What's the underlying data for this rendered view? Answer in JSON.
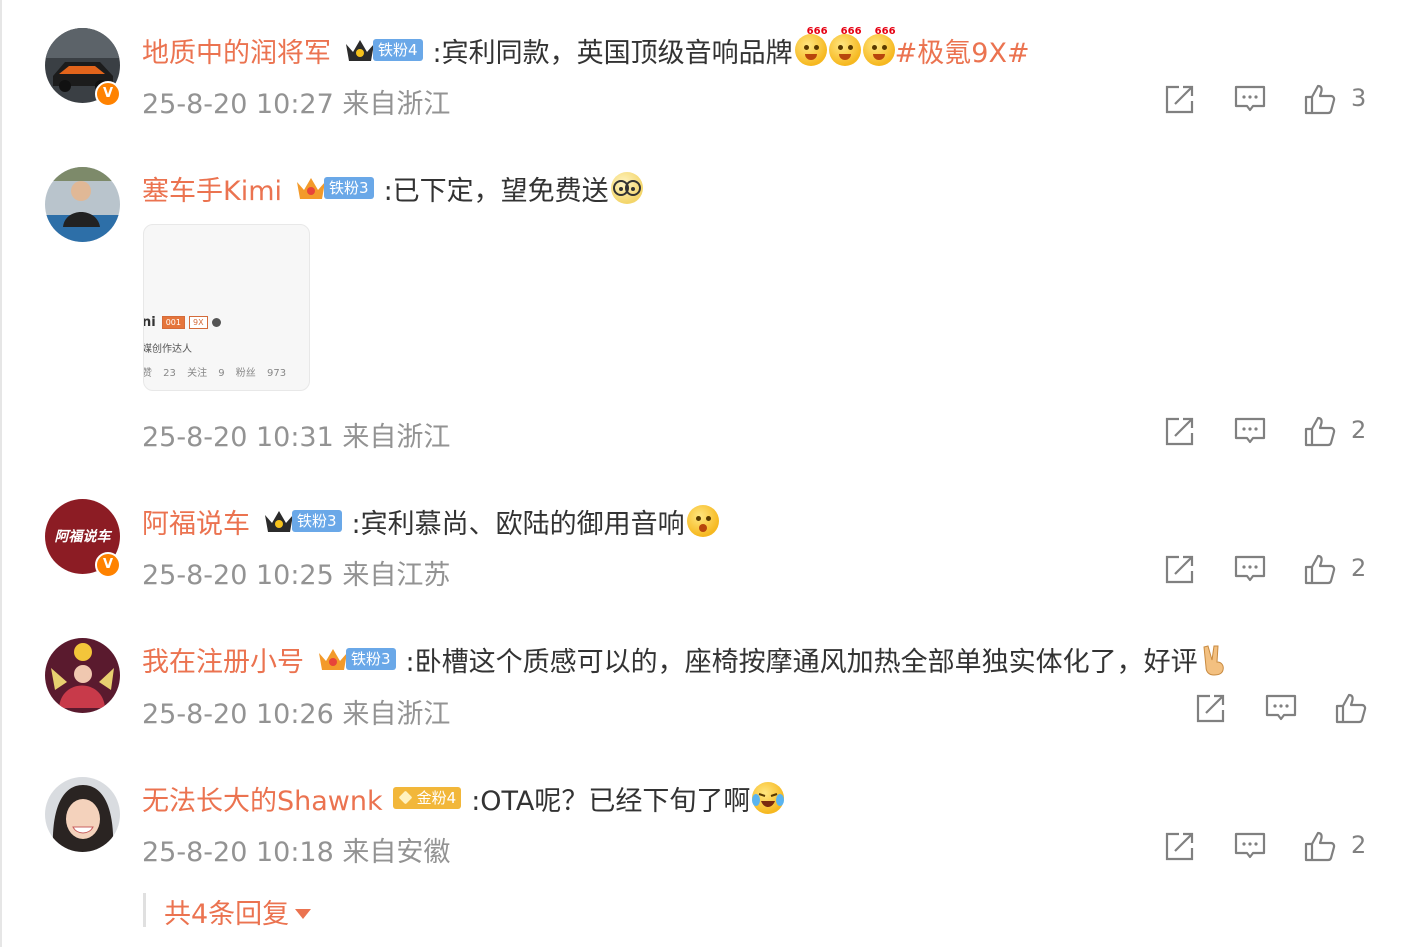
{
  "comments": [
    {
      "user": "地质中的润将军",
      "fan_badge": "铁粉4",
      "text": ":宾利同款，英国顶级音响品牌",
      "emoji": [
        "666-emoji",
        "666-emoji",
        "666-emoji"
      ],
      "topic": "#极氪9X#",
      "time": "25-8-20 10:27 来自浙江",
      "likes": "3",
      "verified": true
    },
    {
      "user": "塞车手Kimi",
      "fan_badge": "铁粉3",
      "text": ":已下定，望免费送",
      "emoji": [
        "glasses-emoji"
      ],
      "attachment": {
        "name": "ni",
        "chip1": "001",
        "chip2": "9X",
        "subtitle": "媒创作达人",
        "stats": "赞 23 关注 9 粉丝 973"
      },
      "time": "25-8-20 10:31 来自浙江",
      "likes": "2",
      "verified": false
    },
    {
      "user": "阿福说车",
      "fan_badge": "铁粉3",
      "text": ":宾利慕尚、欧陆的御用音响",
      "emoji": [
        "surprised-emoji"
      ],
      "time": "25-8-20 10:25 来自江苏",
      "likes": "2",
      "verified": true,
      "avatar_text": "阿福说车"
    },
    {
      "user": "我在注册小号",
      "fan_badge": "铁粉3",
      "text": ":卧槽这个质感可以的，座椅按摩通风加热全部单独实体化了，好评",
      "emoji": [
        "victory-hand-emoji"
      ],
      "time": "25-8-20 10:26 来自浙江",
      "likes": "",
      "verified": false
    },
    {
      "user": "无法长大的Shawnk",
      "fan_badge": "金粉4",
      "text": ":OTA呢？已经下旬了啊",
      "emoji": [
        "crying-laughing-emoji"
      ],
      "time": "25-8-20 10:18 来自安徽",
      "likes": "2",
      "verified": false
    }
  ],
  "reply_link": "共4条回复",
  "colors": {
    "accent": "#eb7350",
    "meta": "#939393",
    "vip": "#ff8200",
    "fan_blue": "#6aa8e8",
    "fan_gold": "#f2b73a"
  },
  "icons": [
    "share-icon",
    "comment-icon",
    "like-icon",
    "verified-icon",
    "crown-icon",
    "caret-down-icon"
  ]
}
